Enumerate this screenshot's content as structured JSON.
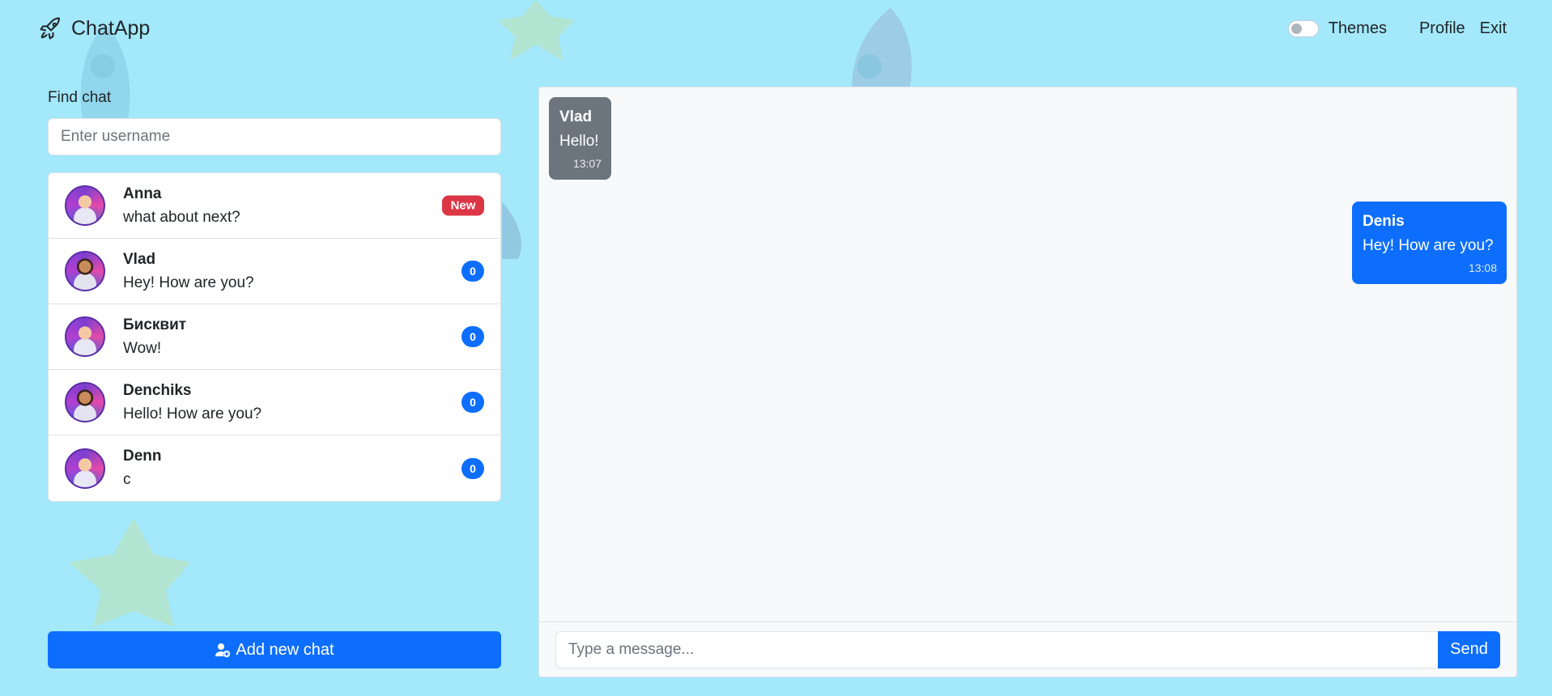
{
  "brand": {
    "name": "ChatApp",
    "icon": "rocket-icon"
  },
  "nav": {
    "themes_label": "Themes",
    "profile_label": "Profile",
    "exit_label": "Exit"
  },
  "sidebar": {
    "find_label": "Find chat",
    "search_placeholder": "Enter username",
    "chats": [
      {
        "name": "Anna",
        "last_message": "what about next?",
        "badge": "New"
      },
      {
        "name": "Vlad",
        "last_message": "Hey! How are you?",
        "badge": "0"
      },
      {
        "name": "Бисквит",
        "last_message": "Wow!",
        "badge": "0"
      },
      {
        "name": "Denchiks",
        "last_message": "Hello! How are you?",
        "badge": "0"
      },
      {
        "name": "Denn",
        "last_message": "c",
        "badge": "0"
      }
    ],
    "add_chat_label": "Add new chat"
  },
  "conversation": {
    "messages": [
      {
        "author": "Vlad",
        "text": "Hello!",
        "time": "13:07"
      },
      {
        "author": "Denis",
        "text": "Hey! How are you?",
        "time": "13:08"
      }
    ],
    "input_placeholder": "Type a message...",
    "send_label": "Send"
  },
  "colors": {
    "background": "#a3e8fb",
    "primary": "#0d6efd",
    "danger": "#dc3545",
    "incoming": "#6c757d"
  }
}
